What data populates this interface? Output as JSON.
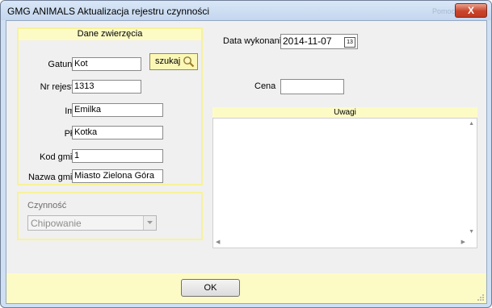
{
  "window": {
    "title": "GMG  ANIMALS   Aktualizacja rejestru czynności",
    "close_label": "X",
    "help_text": "Pomoc"
  },
  "animal": {
    "section_title": "Dane zwierzęcia",
    "gatunek_label": "Gatunek",
    "gatunek_value": "Kot",
    "search_label": "szukaj",
    "nr_rejestru_label": "Nr rejestru",
    "nr_rejestru_value": "1313",
    "imie_label": "Imię",
    "imie_value": "Emilka",
    "plec_label": "Płeć",
    "plec_value": "Kotka",
    "kod_gminy_label": "Kod gminy",
    "kod_gminy_value": "1",
    "nazwa_gminy_label": "Nazwa gminy",
    "nazwa_gminy_value": "Miasto Zielona Góra"
  },
  "activity": {
    "section_title": "Czynność",
    "selected": "Chipowanie"
  },
  "right": {
    "date_label": "Data wykonania",
    "date_value": "2014-11-07",
    "calendar_icon_text": "13",
    "price_label": "Cena",
    "price_value": "",
    "notes_title": "Uwagi",
    "notes_value": ""
  },
  "footer": {
    "ok_label": "OK"
  },
  "colors": {
    "highlight_yellow": "#fdfbc5",
    "border_yellow": "#f7f29a",
    "window_frame": "#cfe0f4",
    "close_red": "#c9442a"
  },
  "icons": [
    "magnifier-icon",
    "calendar-icon",
    "dropdown-arrow-icon",
    "scroll-up-icon",
    "scroll-down-icon",
    "scroll-left-icon",
    "scroll-right-icon",
    "resize-grip-icon"
  ]
}
